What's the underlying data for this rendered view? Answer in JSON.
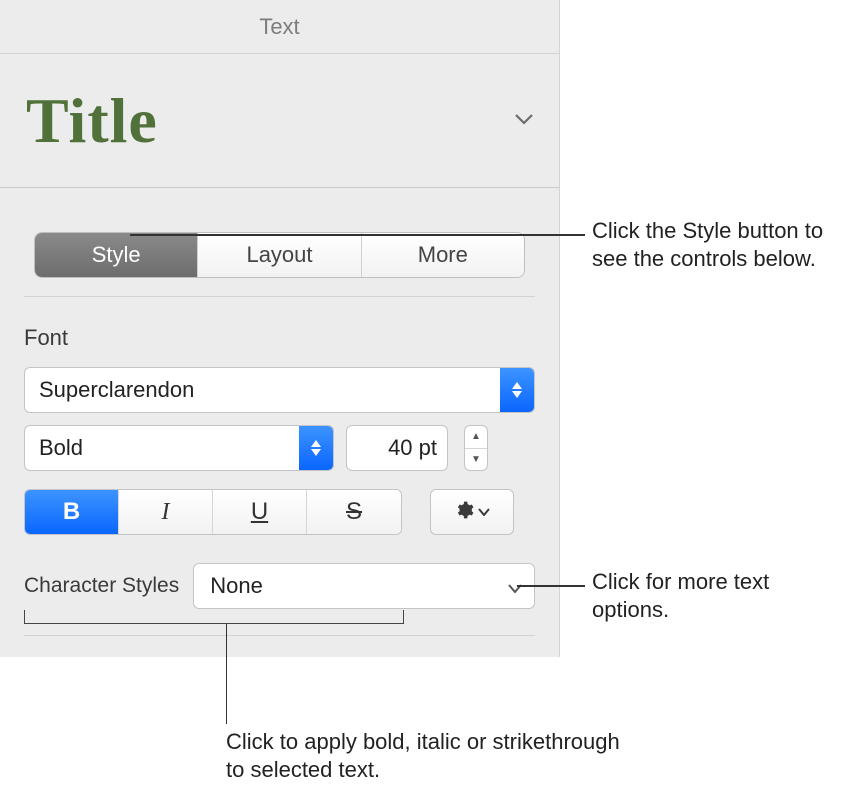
{
  "topbar": {
    "label": "Text"
  },
  "paragraph_style": {
    "name": "Title"
  },
  "tabs": {
    "style": "Style",
    "layout": "Layout",
    "more": "More"
  },
  "font": {
    "section_label": "Font",
    "family": "Superclarendon",
    "weight": "Bold",
    "size": "40 pt"
  },
  "text_styles": {
    "bold_glyph": "B",
    "italic_glyph": "I",
    "underline_glyph": "U",
    "strike_glyph": "S"
  },
  "character_styles": {
    "label": "Character Styles",
    "value": "None"
  },
  "callouts": {
    "style_tab": "Click the Style button to see the controls below.",
    "more_options": "Click for more text options.",
    "bius": "Click to apply bold, italic or strikethrough to selected text."
  }
}
